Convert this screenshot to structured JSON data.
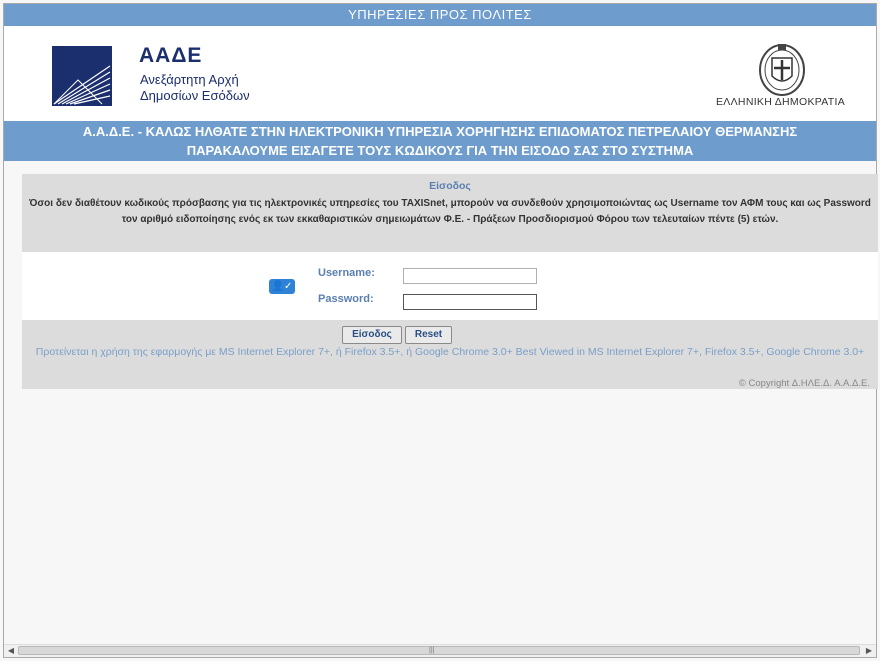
{
  "topbar": {
    "title": "ΥΠΗΡΕΣΙΕΣ ΠΡΟΣ ΠΟΛΙΤΕΣ"
  },
  "header": {
    "logo_name": "ΑΑΔΕ",
    "logo_sub1": "Ανεξάρτητη Αρχή",
    "logo_sub2": "Δημοσίων Εσόδων",
    "emblem_text": "ΕΛΛΗΝΙΚΗ ΔΗΜΟΚΡΑΤΙΑ"
  },
  "banner": {
    "line1": "Α.Α.Δ.Ε. - ΚΑΛΩΣ ΗΛΘΑΤΕ ΣΤΗΝ ΗΛΕΚΤΡΟΝΙΚΗ ΥΠΗΡΕΣΙΑ ΧΟΡΗΓΗΣΗΣ ΕΠΙΔΟΜΑΤΟΣ ΠΕΤΡΕΛΑΙΟΥ ΘΕΡΜΑΝΣΗΣ",
    "line2": "ΠΑΡΑΚΑΛΟΥΜΕ ΕΙΣΑΓΕΤΕ ΤΟΥΣ ΚΩΔΙΚΟΥΣ ΓΙΑ ΤΗΝ ΕΙΣΟΔΟ ΣΑΣ ΣΤΟ ΣΥΣΤΗΜΑ"
  },
  "login": {
    "title": "Είσοδος",
    "info": "Όσοι δεν διαθέτουν κωδικούς πρόσβασης για τις ηλεκτρονικές υπηρεσίες του TAXISnet, μπορούν να συνδεθούν χρησιμοποιώντας ως Username τον ΑΦΜ τους και ως Password τον αριθμό ειδοποίησης ενός εκ των εκκαθαριστικών σημειωμάτων Φ.Ε. - Πράξεων Προσδιορισμού Φόρου των τελευταίων πέντε (5) ετών.",
    "username_label": "Username:",
    "username_value": "",
    "password_label": "Password:",
    "password_value": "",
    "login_button": "Είσοδος",
    "reset_button": "Reset",
    "icon_glyph": "👤✓"
  },
  "footer": {
    "browsers": "Προτείνεται η χρήση της εφαρμογής με MS Internet Explorer 7+, ή Firefox 3.5+, ή Google Chrome 3.0+ Best Viewed in MS Internet Explorer 7+, Firefox 3.5+, Google Chrome 3.0+",
    "copyright": "© Copyright Δ.ΗΛΕ.Δ. Α.Α.Δ.Ε."
  },
  "colors": {
    "bar_blue": "#6d9ccd",
    "logo_navy": "#1b2e6e",
    "label_blue": "#5a7fb0"
  },
  "icons": [
    "aade-logo-icon",
    "greek-emblem-icon",
    "user-check-icon",
    "scroll-left-icon",
    "scroll-right-icon"
  ]
}
